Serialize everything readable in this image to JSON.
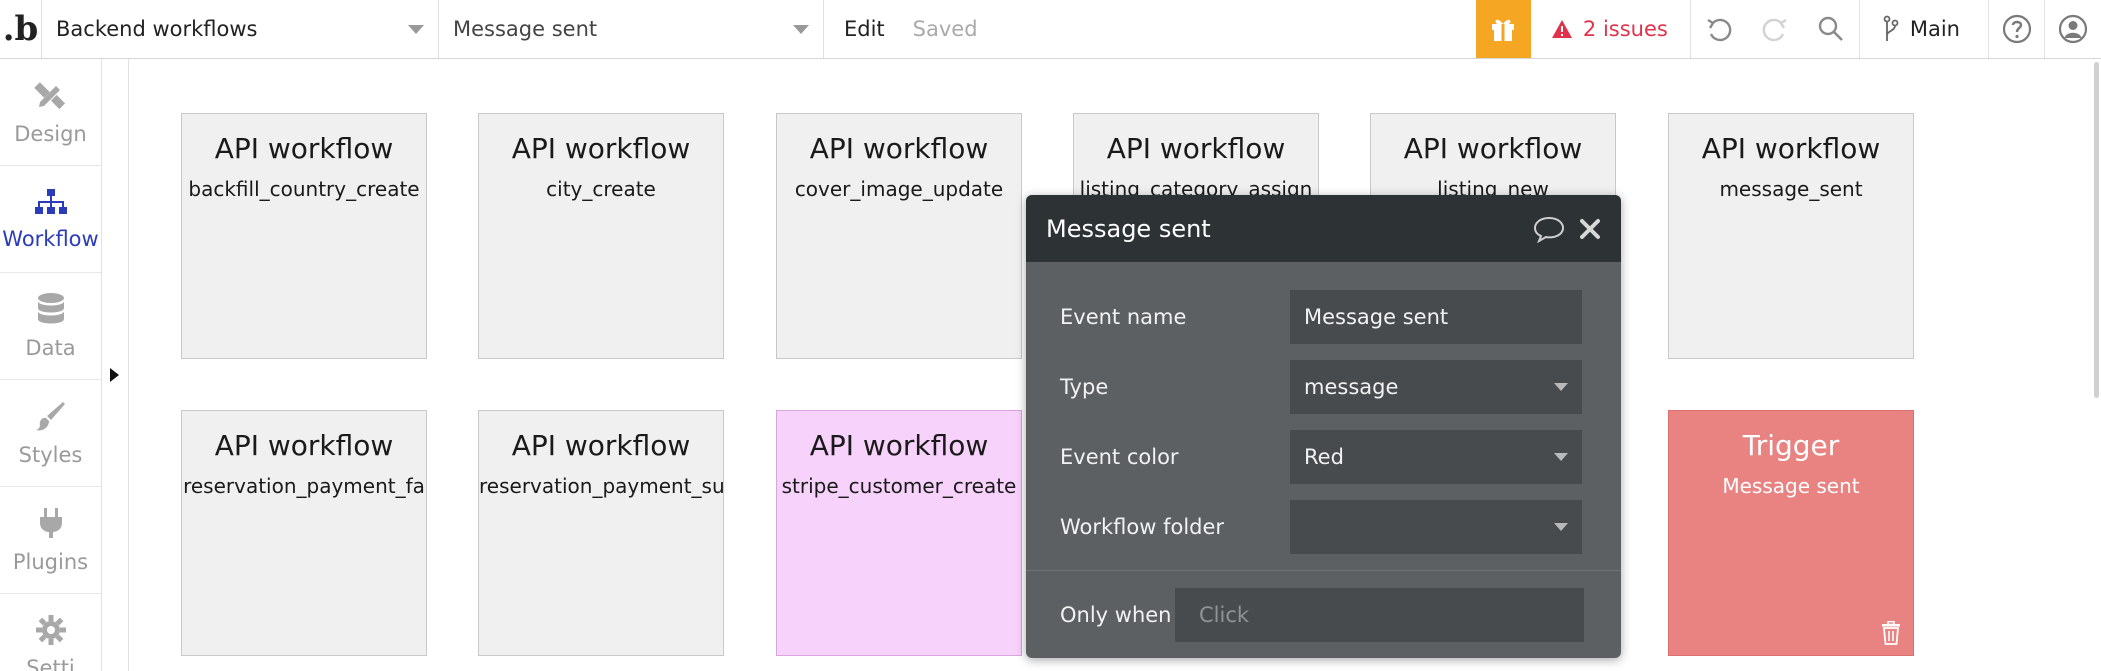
{
  "topbar": {
    "logo": ".b",
    "page_select": "Backend workflows",
    "event_select": "Message sent",
    "edit": "Edit",
    "saved": "Saved",
    "issues": "2 issues",
    "branch": "Main",
    "accent_gift": "#f5a623",
    "issue_color": "#e0334a"
  },
  "sidebar": {
    "items": [
      {
        "label": "Design",
        "icon": "pencil-ruler-icon"
      },
      {
        "label": "Workflow",
        "icon": "sitemap-icon"
      },
      {
        "label": "Data",
        "icon": "database-icon"
      },
      {
        "label": "Styles",
        "icon": "brush-icon"
      },
      {
        "label": "Plugins",
        "icon": "plug-icon"
      },
      {
        "label": "Setti",
        "icon": "gear-icon"
      }
    ],
    "active_color": "#2a3cb8"
  },
  "cards": [
    {
      "title": "API workflow",
      "sub": "backfill_country_create"
    },
    {
      "title": "API workflow",
      "sub": "city_create"
    },
    {
      "title": "API workflow",
      "sub": "cover_image_update"
    },
    {
      "title": "API workflow",
      "sub": "listing_category_assign"
    },
    {
      "title": "API workflow",
      "sub": "listing_new"
    },
    {
      "title": "API workflow",
      "sub": "message_sent"
    },
    {
      "title": "API workflow",
      "sub": "reservation_payment_fa"
    },
    {
      "title": "API workflow",
      "sub": "reservation_payment_su"
    },
    {
      "title": "API workflow",
      "sub": "stripe_customer_create"
    },
    {
      "title": "Trigger",
      "sub": "Message sent"
    }
  ],
  "modal": {
    "title": "Message sent",
    "event_name_label": "Event name",
    "event_name_value": "Message sent",
    "type_label": "Type",
    "type_value": "message",
    "color_label": "Event color",
    "color_value": "Red",
    "folder_label": "Workflow folder",
    "folder_value": "",
    "only_when_label": "Only when",
    "only_when_placeholder": "Click"
  }
}
